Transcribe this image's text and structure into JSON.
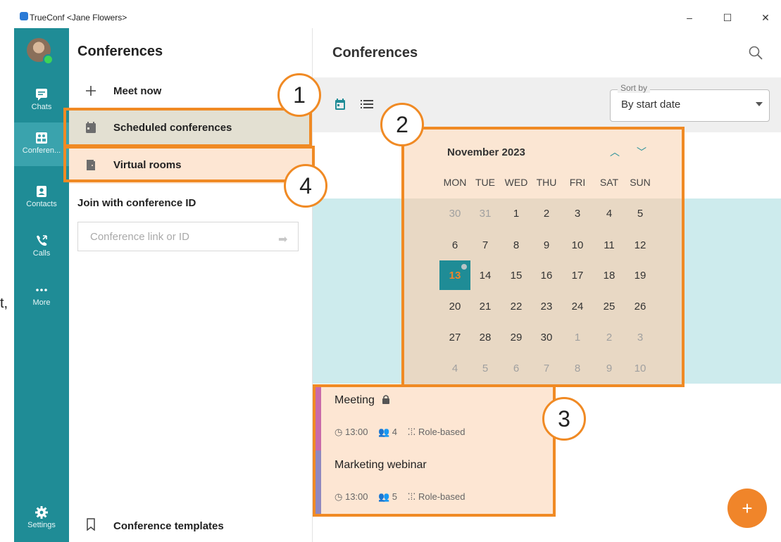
{
  "window": {
    "title": "TrueConf <Jane Flowers>",
    "minimize": "–",
    "maximize": "☐",
    "close": "✕"
  },
  "rail": {
    "items": [
      {
        "label": "Chats",
        "icon": "chat-icon"
      },
      {
        "label": "Conferen...",
        "icon": "conference-icon"
      },
      {
        "label": "Contacts",
        "icon": "contacts-icon"
      },
      {
        "label": "Calls",
        "icon": "calls-icon"
      },
      {
        "label": "More",
        "icon": "more-icon"
      },
      {
        "label": "Settings",
        "icon": "gear-icon"
      }
    ]
  },
  "panel": {
    "title": "Conferences",
    "items": [
      {
        "label": "Meet now",
        "icon": "plus-icon"
      },
      {
        "label": "Scheduled conferences",
        "icon": "calendar-icon"
      },
      {
        "label": "Virtual rooms",
        "icon": "door-icon"
      }
    ],
    "join_label": "Join with conference ID",
    "join_placeholder": "Conference link or ID",
    "templates_label": "Conference templates"
  },
  "main": {
    "title": "Conferences",
    "sort_label": "Sort by",
    "sort_value": "By start date"
  },
  "calendar": {
    "month": "November 2023",
    "weekdays": [
      "MON",
      "TUE",
      "WED",
      "THU",
      "FRI",
      "SAT",
      "SUN"
    ],
    "weeks": [
      [
        "30",
        "31",
        "1",
        "2",
        "3",
        "4",
        "5"
      ],
      [
        "6",
        "7",
        "8",
        "9",
        "10",
        "11",
        "12"
      ],
      [
        "13",
        "14",
        "15",
        "16",
        "17",
        "18",
        "19"
      ],
      [
        "20",
        "21",
        "22",
        "23",
        "24",
        "25",
        "26"
      ],
      [
        "27",
        "28",
        "29",
        "30",
        "1",
        "2",
        "3"
      ],
      [
        "4",
        "5",
        "6",
        "7",
        "8",
        "9",
        "10"
      ]
    ],
    "today": "13"
  },
  "events": [
    {
      "title": "Meeting",
      "time": "13:00",
      "participants": "4",
      "mode": "Role-based",
      "locked": true
    },
    {
      "title": "Marketing webinar",
      "time": "13:00",
      "participants": "5",
      "mode": "Role-based",
      "locked": false
    }
  ],
  "annotations": [
    "1",
    "2",
    "3",
    "4"
  ],
  "fab_label": "+",
  "cutoff_text": "t,",
  "colors": {
    "accent": "#1f8c96",
    "annotation": "#f08a24",
    "event_bg": "#fde6d3",
    "fab": "#f0852a"
  }
}
